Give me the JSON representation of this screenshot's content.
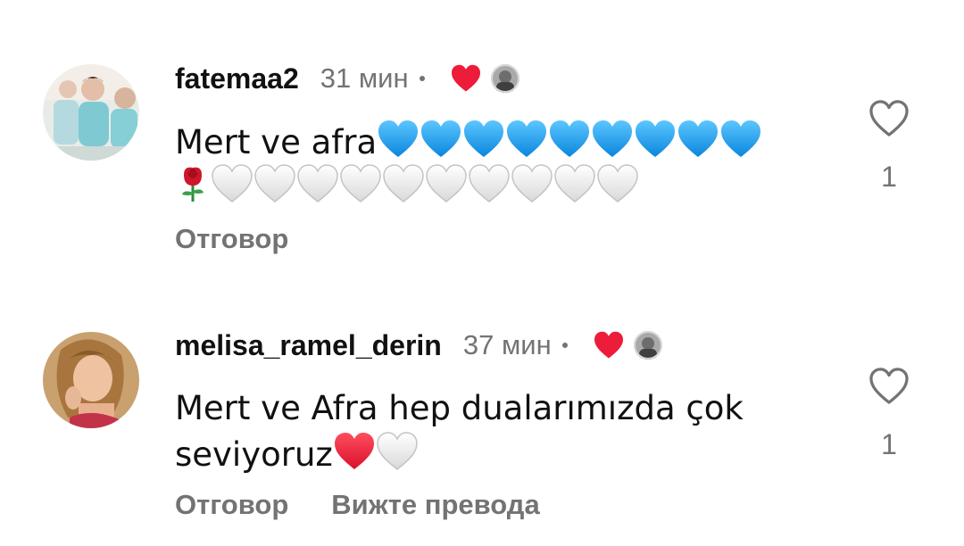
{
  "comments": [
    {
      "username": "fatemaa2",
      "time": "31 мин",
      "text_prefix": "Mert ve afra",
      "emoji_line1": "blue-heart x9",
      "emoji_line2": "rose, white-heart x10",
      "reply_label": "Отговор",
      "like_count": "1",
      "liked_by_author": true
    },
    {
      "username": "melisa_ramel_derin",
      "time": "37 мин",
      "text_line1": "Mert ve Afra hep dualarımızda çok",
      "text_line2": "seviyoruz",
      "reply_label": "Отговор",
      "translate_label": "Вижте превода",
      "like_count": "1",
      "liked_by_author": true
    }
  ],
  "colors": {
    "text": "#111111",
    "muted": "#737373",
    "heart_red": "#ed1c3a",
    "heart_blue": "#1ba0ee"
  },
  "icons": {
    "like": "heart-outline-icon",
    "author_like": "red-heart-icon"
  }
}
